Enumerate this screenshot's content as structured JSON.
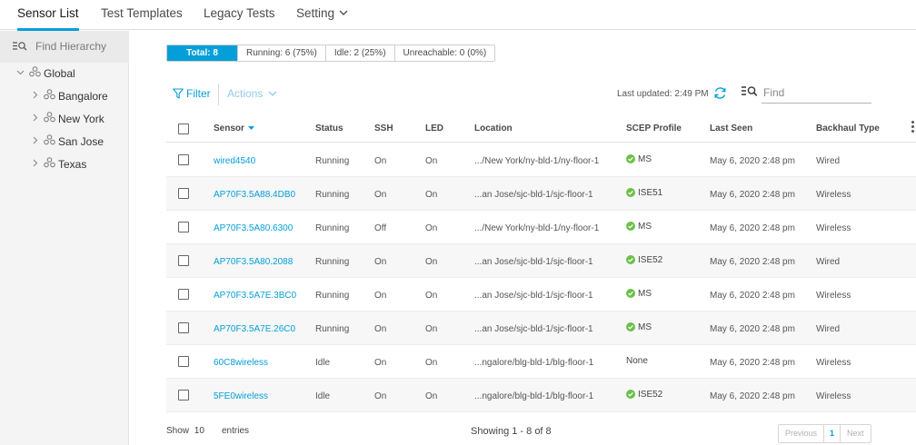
{
  "tabs": [
    {
      "label": "Sensor List"
    },
    {
      "label": "Test Templates"
    },
    {
      "label": "Legacy Tests"
    },
    {
      "label": "Setting"
    }
  ],
  "sidebar": {
    "search_placeholder": "Find Hierarchy",
    "root": {
      "label": "Global"
    },
    "children": [
      {
        "label": "Bangalore"
      },
      {
        "label": "New York"
      },
      {
        "label": "San Jose"
      },
      {
        "label": "Texas"
      }
    ]
  },
  "status": {
    "total": "Total: 8",
    "running": "Running: 6 (75%)",
    "idle": "Idle: 2 (25%)",
    "unreachable": "Unreachable: 0 (0%)"
  },
  "toolbar": {
    "filter_label": "Filter",
    "actions_label": "Actions",
    "last_updated": "Last updated: 2:49 PM",
    "find_placeholder": "Find"
  },
  "table": {
    "columns": {
      "sensor": "Sensor",
      "status": "Status",
      "ssh": "SSH",
      "led": "LED",
      "location": "Location",
      "scep": "SCEP Profile",
      "last_seen": "Last Seen",
      "backhaul": "Backhaul Type"
    },
    "rows": [
      {
        "sensor": "wired4540",
        "status": "Running",
        "ssh": "On",
        "led": "On",
        "location": ".../New York/ny-bld-1/ny-floor-1",
        "scep": "MS",
        "scep_ok": true,
        "last_seen": "May 6, 2020 2:48 pm",
        "backhaul": "Wired"
      },
      {
        "sensor": "AP70F3.5A88.4DB0",
        "status": "Running",
        "ssh": "On",
        "led": "On",
        "location": "...an Jose/sjc-bld-1/sjc-floor-1",
        "scep": "ISE51",
        "scep_ok": true,
        "last_seen": "May 6, 2020 2:48 pm",
        "backhaul": "Wireless"
      },
      {
        "sensor": "AP70F3.5A80.6300",
        "status": "Running",
        "ssh": "Off",
        "led": "On",
        "location": ".../New York/ny-bld-1/ny-floor-1",
        "scep": "MS",
        "scep_ok": true,
        "last_seen": "May 6, 2020 2:48 pm",
        "backhaul": "Wireless"
      },
      {
        "sensor": "AP70F3.5A80.2088",
        "status": "Running",
        "ssh": "On",
        "led": "On",
        "location": "...an Jose/sjc-bld-1/sjc-floor-1",
        "scep": "ISE52",
        "scep_ok": true,
        "last_seen": "May 6, 2020 2:48 pm",
        "backhaul": "Wired"
      },
      {
        "sensor": "AP70F3.5A7E.3BC0",
        "status": "Running",
        "ssh": "On",
        "led": "On",
        "location": "...an Jose/sjc-bld-1/sjc-floor-1",
        "scep": "MS",
        "scep_ok": true,
        "last_seen": "May 6, 2020 2:48 pm",
        "backhaul": "Wireless"
      },
      {
        "sensor": "AP70F3.5A7E.26C0",
        "status": "Running",
        "ssh": "On",
        "led": "On",
        "location": "...an Jose/sjc-bld-1/sjc-floor-1",
        "scep": "MS",
        "scep_ok": true,
        "last_seen": "May 6, 2020 2:48 pm",
        "backhaul": "Wired"
      },
      {
        "sensor": "60C8wireless",
        "status": "Idle",
        "ssh": "On",
        "led": "On",
        "location": "...ngalore/blg-bld-1/blg-floor-1",
        "scep": "None",
        "scep_ok": false,
        "last_seen": "May 6, 2020 2:48 pm",
        "backhaul": "Wireless"
      },
      {
        "sensor": "5FE0wireless",
        "status": "Idle",
        "ssh": "On",
        "led": "On",
        "location": "...ngalore/blg-bld-1/blg-floor-1",
        "scep": "ISE52",
        "scep_ok": true,
        "last_seen": "May 6, 2020 2:48 pm",
        "backhaul": "Wireless"
      }
    ]
  },
  "footer": {
    "show_label": "Show",
    "show_count": "10",
    "entries_label": "entries",
    "showing": "Showing 1 - 8 of 8",
    "prev": "Previous",
    "page": "1",
    "next": "Next"
  },
  "colors": {
    "accent": "#049fd9",
    "ok": "#6cc04a"
  }
}
